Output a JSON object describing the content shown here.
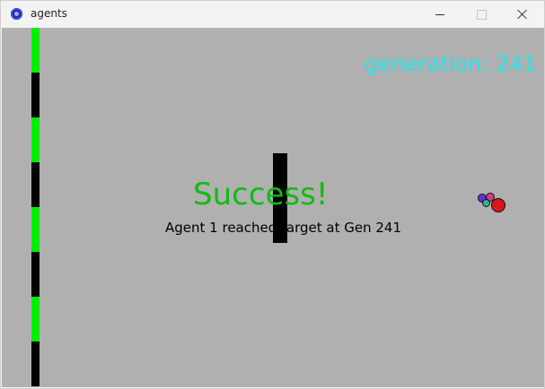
{
  "window": {
    "title": "agents",
    "app_icon": "app-globe-icon",
    "controls": [
      "minimize-icon",
      "maximize-icon",
      "close-icon"
    ]
  },
  "canvas": {
    "background": "#b0b0b0",
    "generation_text": "generation: 241",
    "generation_color": "#22e6ee",
    "success_text": "Success!",
    "success_color": "#11bb11",
    "message_text": "Agent 1 reached target at Gen 241",
    "progress_segments": [
      "#00ee00",
      "#000000",
      "#00ee00",
      "#000000",
      "#00ee00",
      "#000000",
      "#00ee00",
      "#000000"
    ],
    "agent_colors": [
      "#6a2fd6",
      "#d23c8a",
      "#27b5a0",
      "#d51818"
    ]
  }
}
